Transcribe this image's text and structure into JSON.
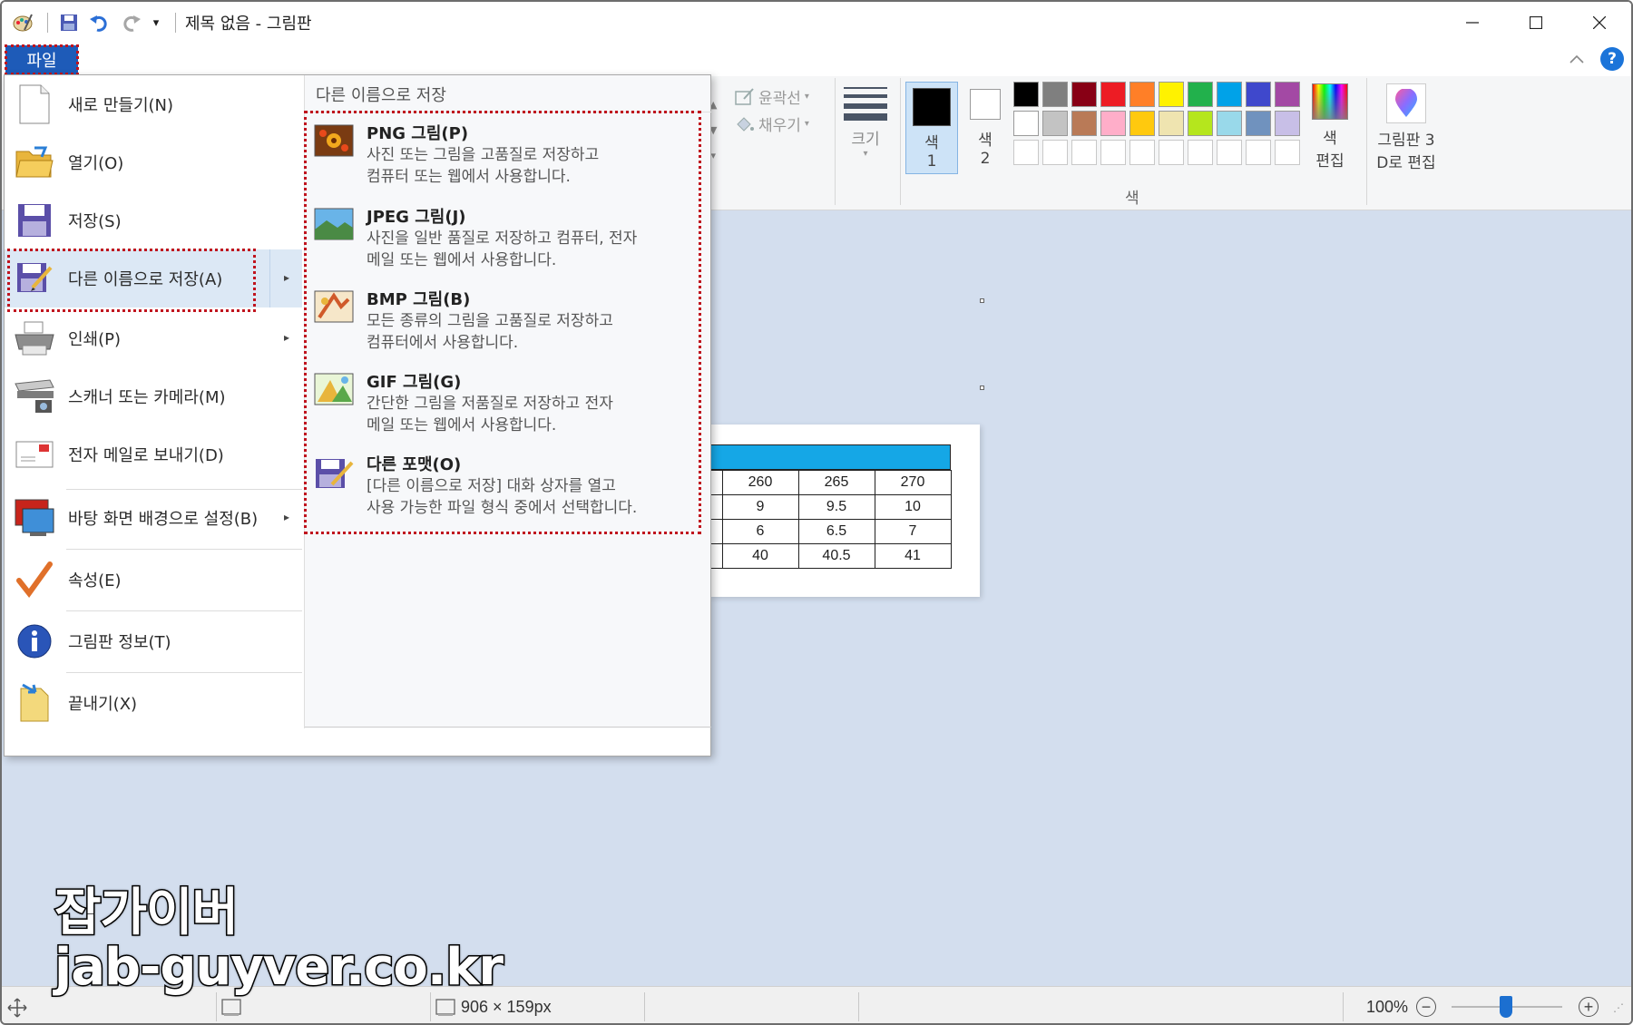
{
  "window": {
    "title": "제목 없음 - 그림판",
    "qat_overflow": "▾"
  },
  "ribbon": {
    "file_tab": "파일",
    "outline_label": "윤곽선",
    "fill_label": "채우기",
    "size_label": "크기",
    "color1_label_a": "색",
    "color1_label_b": "1",
    "color2_label_a": "색",
    "color2_label_b": "2",
    "edit_colors_a": "색",
    "edit_colors_b": "편집",
    "paint3d_a": "그림판 3",
    "paint3d_b": "D로 편집",
    "colors_group_label": "색",
    "palette_row1": [
      "#000000",
      "#7f7f7f",
      "#880015",
      "#ed1c24",
      "#ff7f27",
      "#fff200",
      "#22b14c",
      "#00a2e8",
      "#3f48cc",
      "#a349a4"
    ],
    "palette_row2": [
      "#ffffff",
      "#c3c3c3",
      "#b97a57",
      "#ffaec9",
      "#ffc90e",
      "#efe4b0",
      "#b5e61d",
      "#99d9ea",
      "#7092be",
      "#c8bfe7"
    ]
  },
  "file_menu": {
    "items": [
      {
        "label": "새로 만들기(N)"
      },
      {
        "label": "열기(O)"
      },
      {
        "label": "저장(S)"
      },
      {
        "label": "다른 이름으로 저장(A)"
      },
      {
        "label": "인쇄(P)"
      },
      {
        "label": "스캐너 또는 카메라(M)"
      },
      {
        "label": "전자 메일로 보내기(D)"
      },
      {
        "label": "바탕 화면 배경으로 설정(B)"
      },
      {
        "label": "속성(E)"
      },
      {
        "label": "그림판 정보(T)"
      },
      {
        "label": "끝내기(X)"
      }
    ],
    "submenu_heading": "다른 이름으로 저장",
    "submenu": [
      {
        "title": "PNG 그림(P)",
        "line1": "사진 또는 그림을 고품질로 저장하고",
        "line2": "컴퓨터 또는 웹에서 사용합니다."
      },
      {
        "title": "JPEG 그림(J)",
        "line1": "사진을 일반 품질로 저장하고 컴퓨터, 전자",
        "line2": "메일 또는 웹에서 사용합니다."
      },
      {
        "title": "BMP 그림(B)",
        "line1": "모든 종류의 그림을 고품질로 저장하고",
        "line2": "컴퓨터에서 사용합니다."
      },
      {
        "title": "GIF 그림(G)",
        "line1": "간단한 그림을 저품질로 저장하고 전자",
        "line2": "메일 또는 웹에서 사용합니다."
      },
      {
        "title": "다른 포맷(O)",
        "line1": "[다른 이름으로 저장] 대화 상자를 열고",
        "line2": "사용 가능한 파일 형식 중에서 선택합니다."
      }
    ]
  },
  "canvas_table": {
    "rows": [
      [
        "260",
        "265",
        "270"
      ],
      [
        "9",
        "9.5",
        "10"
      ],
      [
        "6",
        "6.5",
        "7"
      ],
      [
        "40",
        "40.5",
        "41"
      ]
    ]
  },
  "statusbar": {
    "dimensions": "906 × 159px",
    "zoom": "100%",
    "zoom_level": 1.0
  },
  "watermark": {
    "line1": "잡가이버",
    "line2": "jab-guyver.co.kr"
  }
}
